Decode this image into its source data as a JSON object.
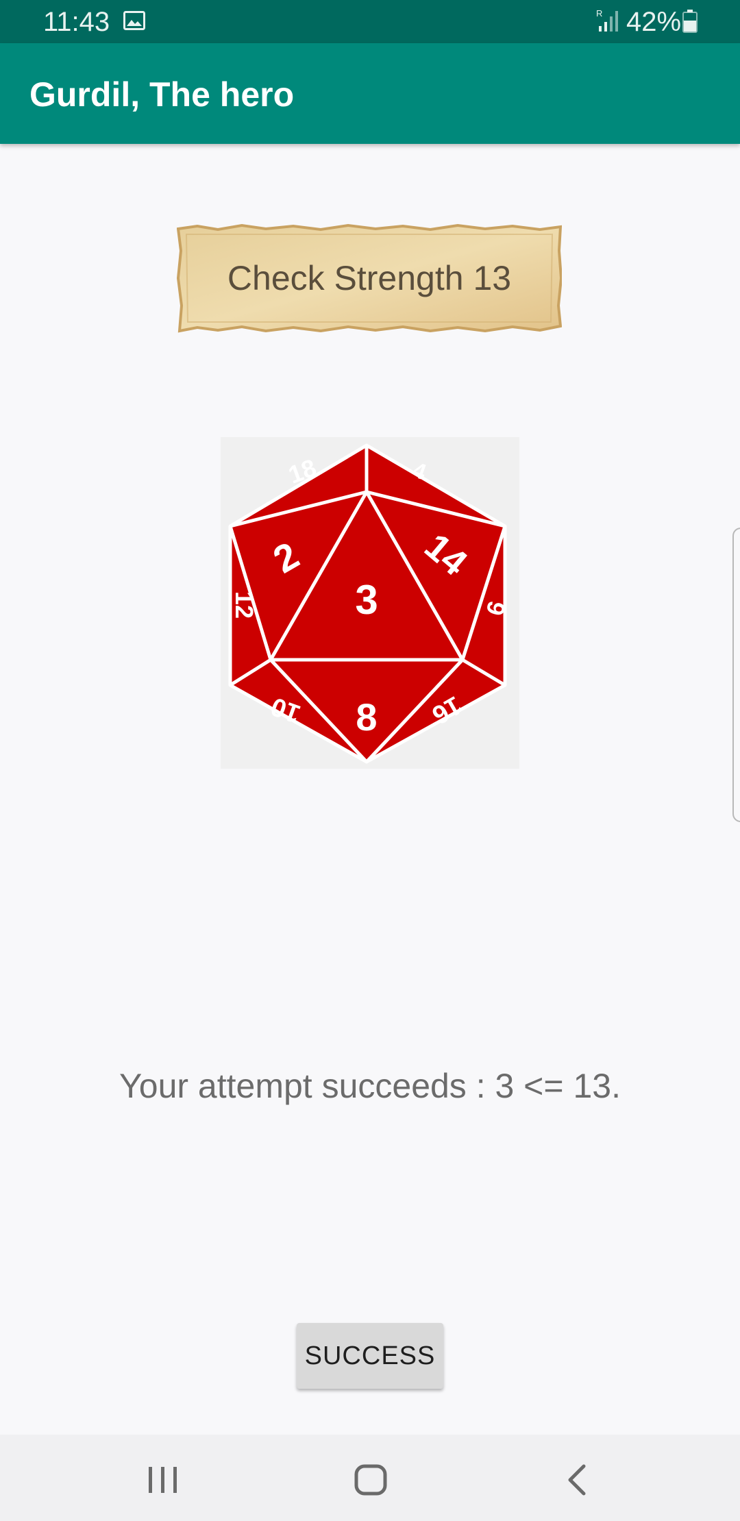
{
  "status_bar": {
    "time": "11:43",
    "battery": "42%",
    "icons": [
      "image-icon",
      "signal-icon",
      "battery-icon"
    ]
  },
  "app_bar": {
    "title": "Gurdil, The hero"
  },
  "check": {
    "label": "Check Strength 13"
  },
  "dice": {
    "rolled_value": "3",
    "face_numbers": [
      "18",
      "4",
      "2",
      "14",
      "12",
      "6",
      "10",
      "8",
      "16"
    ],
    "color": "#cc0000"
  },
  "result": {
    "message": "Your attempt succeeds : 3 <= 13."
  },
  "action": {
    "button_label": "SUCCESS"
  },
  "nav_bar": {
    "icons": [
      "recents-icon",
      "home-icon",
      "back-icon"
    ]
  },
  "colors": {
    "status_bar": "#00695e",
    "app_bar": "#00897b",
    "background": "#f8f8fa",
    "button": "#d9d9d9"
  }
}
